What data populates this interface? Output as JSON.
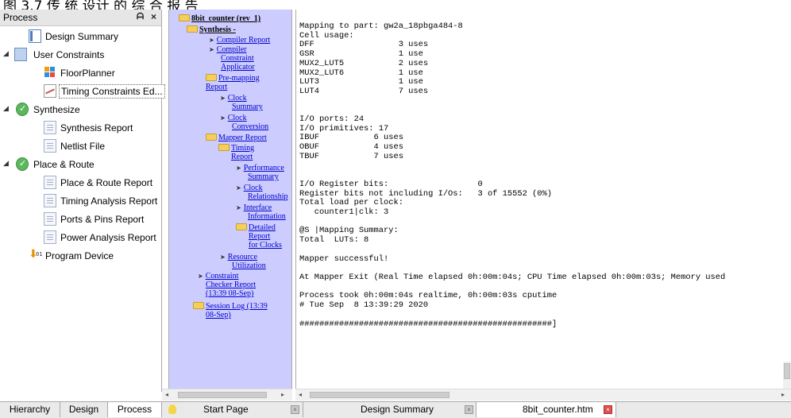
{
  "top_strip_text": "图 3.7 传 统 设计 的 综 合 报 告",
  "process_panel": {
    "title": "Process",
    "pin_icon": "pin-icon",
    "close_icon": "close-icon",
    "items": [
      {
        "label": "Design Summary",
        "icon": "summary-icon",
        "expander": "",
        "level": 1
      },
      {
        "label": "User Constraints",
        "icon": "constraints-icon",
        "expander": "◢",
        "level": 0
      },
      {
        "label": "FloorPlanner",
        "icon": "floorplanner-icon",
        "expander": "",
        "level": 1
      },
      {
        "label": "Timing Constraints Ed...",
        "icon": "timing-icon",
        "expander": "",
        "level": 1,
        "selected": true
      },
      {
        "label": "Synthesize",
        "icon": "check-icon",
        "expander": "◢",
        "level": 0
      },
      {
        "label": "Synthesis Report",
        "icon": "doc-icon",
        "expander": "",
        "level": 1
      },
      {
        "label": "Netlist File",
        "icon": "doc-icon",
        "expander": "",
        "level": 1
      },
      {
        "label": "Place & Route",
        "icon": "check-icon",
        "expander": "◢",
        "level": 0
      },
      {
        "label": "Place & Route Report",
        "icon": "doc-icon",
        "expander": "",
        "level": 1
      },
      {
        "label": "Timing Analysis Report",
        "icon": "doc-icon",
        "expander": "",
        "level": 1
      },
      {
        "label": "Ports & Pins Report",
        "icon": "doc-icon",
        "expander": "",
        "level": 1
      },
      {
        "label": "Power Analysis Report",
        "icon": "doc-icon",
        "expander": "",
        "level": 1
      },
      {
        "label": "Program Device",
        "icon": "program-icon",
        "expander": "",
        "level": 0
      }
    ]
  },
  "left_tabs": [
    "Hierarchy",
    "Design",
    "Process"
  ],
  "report_tree": {
    "root": "8bit_counter (rev_1)",
    "synthesis": "Synthesis -",
    "compiler_report": "Compiler Report",
    "compiler_constraint_1": "Compiler",
    "compiler_constraint_2": "Constraint",
    "compiler_constraint_3": "Applicator",
    "premapping_1": "Pre-mapping",
    "premapping_2": "Report",
    "clock_summary_1": "Clock",
    "clock_summary_2": "Summary",
    "clock_conversion_1": "Clock",
    "clock_conversion_2": "Conversion",
    "mapper_report": "Mapper Report",
    "timing_report_1": "Timing",
    "timing_report_2": "Report",
    "performance_1": "Performance",
    "performance_2": "Summary",
    "clock_rel_1": "Clock",
    "clock_rel_2": "Relationship",
    "interface_1": "Interface",
    "interface_2": "Information",
    "detailed_1": "Detailed",
    "detailed_2": "Report",
    "detailed_3": "for Clocks",
    "resource_1": "Resource",
    "resource_2": "Utilization",
    "constraint_checker_1": "Constraint",
    "constraint_checker_2": "Checker Report",
    "constraint_checker_3": "(13:39 08-Sep)",
    "session_log_1": "Session Log (13:39",
    "session_log_2": "08-Sep)"
  },
  "console_text": "Mapping to part: gw2a_18pbga484-8\nCell usage:\nDFF                 3 uses\nGSR                 1 use\nMUX2_LUT5           2 uses\nMUX2_LUT6           1 use\nLUT3                1 use\nLUT4                7 uses\n\n\nI/O ports: 24\nI/O primitives: 17\nIBUF           6 uses\nOBUF           4 uses\nTBUF           7 uses\n\n\nI/O Register bits:                  0\nRegister bits not including I/Os:   3 of 15552 (0%)\nTotal load per clock:\n   counter1|clk: 3\n\n@S |Mapping Summary:\nTotal  LUTs: 8\n\nMapper successful!\n\nAt Mapper Exit (Real Time elapsed 0h:00m:04s; CPU Time elapsed 0h:00m:03s; Memory used\n\nProcess took 0h:00m:04s realtime, 0h:00m:03s cputime\n# Tue Sep  8 13:39:29 2020\n\n###################################################]",
  "doc_tabs": [
    {
      "label": "Start Page",
      "icon": "lightbulb-icon",
      "active": false
    },
    {
      "label": "Design Summary",
      "icon": "",
      "active": false
    },
    {
      "label": "8bit_counter.htm",
      "icon": "page-icon",
      "active": true
    }
  ],
  "scroll_glyphs": {
    "left": "◂",
    "right": "▸",
    "grip": "III"
  }
}
